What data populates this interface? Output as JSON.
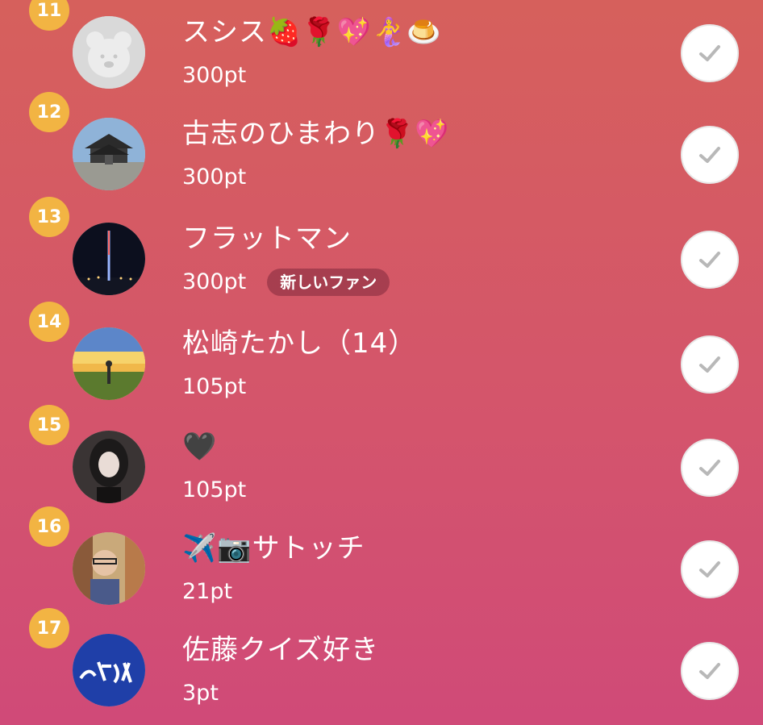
{
  "fans": [
    {
      "rank": "11",
      "name": "スシス🍓🌹💖🧜‍♀️🍮",
      "points": "300pt",
      "badge": ""
    },
    {
      "rank": "12",
      "name": "古志のひまわり🌹💖",
      "points": "300pt",
      "badge": ""
    },
    {
      "rank": "13",
      "name": "フラットマン",
      "points": "300pt",
      "badge": "新しいファン"
    },
    {
      "rank": "14",
      "name": "松崎たかし（14）",
      "points": "105pt",
      "badge": ""
    },
    {
      "rank": "15",
      "name": "🖤",
      "points": "105pt",
      "badge": ""
    },
    {
      "rank": "16",
      "name": "✈️📷サトッチ",
      "points": "21pt",
      "badge": ""
    },
    {
      "rank": "17",
      "name": "佐藤クイズ好き",
      "points": "3pt",
      "badge": ""
    }
  ],
  "icons": {
    "check": "check-icon",
    "rank_badge_color": "#f2b443"
  }
}
